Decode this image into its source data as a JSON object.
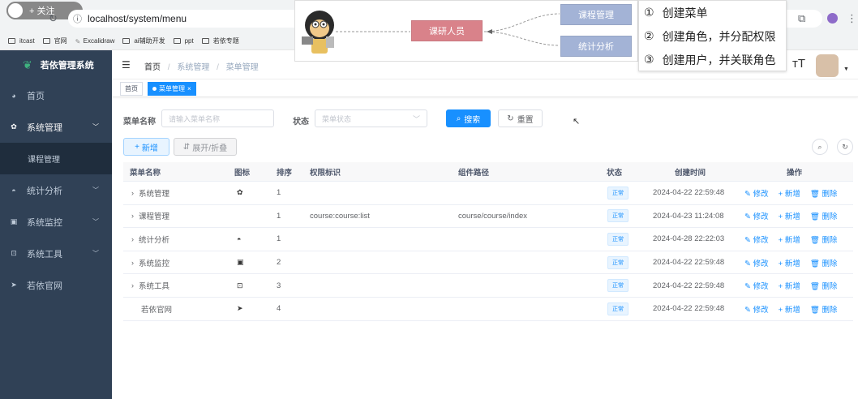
{
  "browser": {
    "url": "localhost/system/menu",
    "follow_label": "+ 关注",
    "bookmarks": [
      "itcast",
      "官网",
      "Excalidraw",
      "ai辅助开发",
      "ppt",
      "若依专题"
    ]
  },
  "overlay": {
    "role_box": "课研人员",
    "branch_top": "课程管理",
    "branch_bottom": "统计分析",
    "steps": [
      "创建菜单",
      "创建角色，并分配权限",
      "创建用户，并关联角色"
    ],
    "step_markers": [
      "①",
      "②",
      "③"
    ]
  },
  "sidebar": {
    "title": "若依管理系统",
    "items": [
      {
        "label": "首页",
        "icon": "dashboard-icon"
      },
      {
        "label": "系统管理",
        "icon": "gear-icon"
      },
      {
        "label": "课程管理",
        "icon": ""
      },
      {
        "label": "统计分析",
        "icon": "gauge-icon"
      },
      {
        "label": "系统监控",
        "icon": "monitor-icon"
      },
      {
        "label": "系统工具",
        "icon": "toolbox-icon"
      },
      {
        "label": "若依官网",
        "icon": "send-icon"
      }
    ]
  },
  "topbar": {
    "breadcrumb": [
      "首页",
      "系统管理",
      "菜单管理"
    ],
    "font_icon": "тT"
  },
  "tags": [
    "首页",
    "菜单管理"
  ],
  "search": {
    "menu_name_label": "菜单名称",
    "menu_name_placeholder": "请输入菜单名称",
    "status_label": "状态",
    "status_placeholder": "菜单状态",
    "search_btn": "搜索",
    "reset_btn": "重置"
  },
  "toolbar": {
    "add_btn": "新增",
    "expand_btn": "展开/折叠"
  },
  "table": {
    "headers": [
      "菜单名称",
      "图标",
      "排序",
      "权限标识",
      "组件路径",
      "状态",
      "创建时间",
      "操作"
    ],
    "rows": [
      {
        "name": "系统管理",
        "icon": "gear-icon",
        "order": "1",
        "perm": "",
        "component": "",
        "status": "正常",
        "created": "2024-04-22 22:59:48"
      },
      {
        "name": "课程管理",
        "icon": "",
        "order": "1",
        "perm": "course:course:list",
        "component": "course/course/index",
        "status": "正常",
        "created": "2024-04-23 11:24:08"
      },
      {
        "name": "统计分析",
        "icon": "gauge-icon",
        "order": "1",
        "perm": "",
        "component": "",
        "status": "正常",
        "created": "2024-04-28 22:22:03"
      },
      {
        "name": "系统监控",
        "icon": "monitor-icon",
        "order": "2",
        "perm": "",
        "component": "",
        "status": "正常",
        "created": "2024-04-22 22:59:48"
      },
      {
        "name": "系统工具",
        "icon": "toolbox-icon",
        "order": "3",
        "perm": "",
        "component": "",
        "status": "正常",
        "created": "2024-04-22 22:59:48"
      },
      {
        "name": "若依官网",
        "icon": "send-icon",
        "order": "4",
        "perm": "",
        "component": "",
        "status": "正常",
        "created": "2024-04-22 22:59:48"
      }
    ],
    "ops": {
      "edit": "修改",
      "add": "新增",
      "delete": "删除"
    }
  },
  "colors": {
    "primary": "#1890ff",
    "sidebar": "#304156",
    "role_box": "#d9828a",
    "branch_box": "#a3b3d6"
  }
}
